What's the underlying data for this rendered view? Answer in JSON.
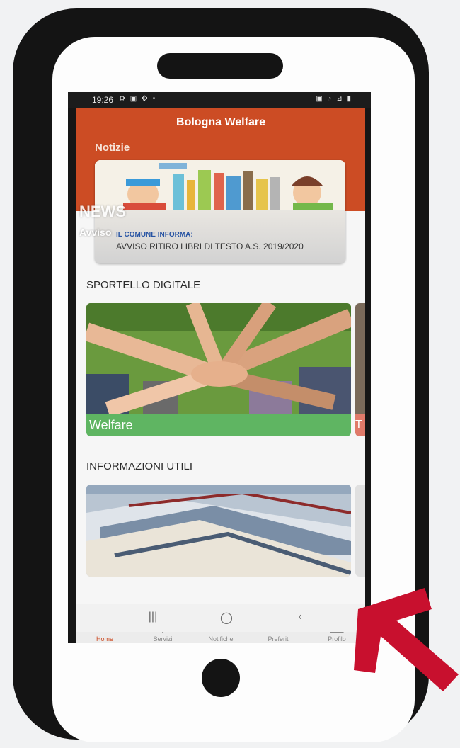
{
  "status_bar": {
    "time": "19:26",
    "left_icons": "⚙ ▣ ⚙ •",
    "right_icons": "▣ ◔ ⊿ ▮"
  },
  "app": {
    "title": "Bologna Welfare"
  },
  "news": {
    "section_label": "Notizie",
    "card_title": "IL COMUNE INFORMA:",
    "card_text": "AVVISO RITIRO LIBRI DI TESTO A.S. 2019/2020",
    "overlay_big": "NEWS",
    "overlay_small": "Avviso"
  },
  "sportello": {
    "section_title": "SPORTELLO DIGITALE",
    "card_label": "Welfare",
    "peek_label": "T"
  },
  "info": {
    "section_title": "INFORMAZIONI UTILI"
  },
  "bottom_nav": {
    "items": [
      {
        "label": "Home",
        "icon": "home-icon",
        "glyph": "⌂"
      },
      {
        "label": "Servizi",
        "icon": "search-icon",
        "glyph": "⚲"
      },
      {
        "label": "Notifiche",
        "icon": "mail-icon",
        "glyph": "✉"
      },
      {
        "label": "Preferiti",
        "icon": "heart-icon",
        "glyph": "♡"
      },
      {
        "label": "Profilo",
        "icon": "user-icon",
        "glyph": "👤"
      }
    ],
    "active_index": 0
  },
  "system_nav": {
    "recent": "|||",
    "home": "◯",
    "back": "‹"
  },
  "colors": {
    "brand_orange": "#cc4c24",
    "welfare_green": "#5fb562",
    "arrow_red": "#c8102e"
  }
}
